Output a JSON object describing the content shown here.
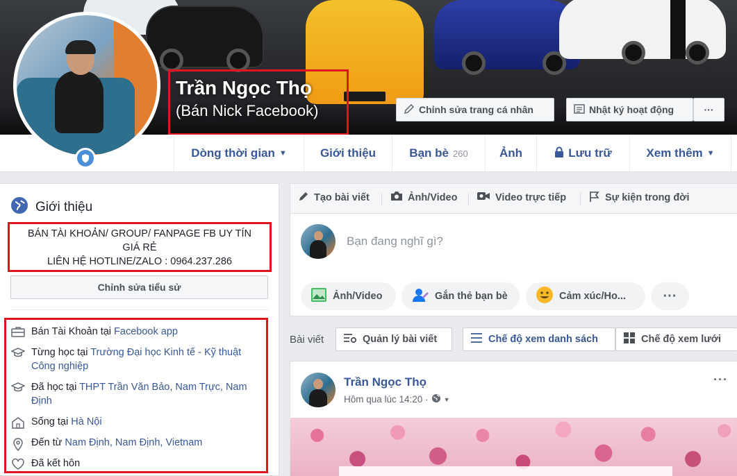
{
  "profile": {
    "name": "Trần Ngọc Thọ",
    "alt_name": "(Bán Nick Facebook)"
  },
  "cover_buttons": {
    "edit_profile": "Chỉnh sửa trang cá nhân",
    "activity_log": "Nhật ký hoạt động",
    "more": "···"
  },
  "nav": {
    "timeline": "Dòng thời gian",
    "about": "Giới thiệu",
    "friends": "Bạn bè",
    "friends_count": "260",
    "photos": "Ảnh",
    "archive": "Lưu trữ",
    "more": "Xem thêm"
  },
  "intro": {
    "title": "Giới thiệu",
    "bio_line1": "BÁN TÀI KHOẢN/ GROUP/ FANPAGE FB UY TÍN",
    "bio_line2": "GIÁ RẺ",
    "bio_line3": "LIÊN HỆ HOTLINE/ZALO : 0964.237.286",
    "edit_bio": "Chỉnh sửa tiểu sử",
    "work_prefix": "Bán Tài Khoản tại ",
    "work_link": "Facebook app",
    "college_prefix": "Từng học tại ",
    "college_link": "Trường Đại học Kinh tế - Kỹ thuật Công nghiệp",
    "highschool_prefix": "Đã học tại ",
    "highschool_link": "THPT Trần Văn Bảo, Nam Trực, Nam Định",
    "lives_prefix": "Sống tại ",
    "lives_link": "Hà Nội",
    "from_prefix": "Đến từ ",
    "from_link": "Nam Định, Nam Định, Vietnam",
    "relationship": "Đã kết hôn"
  },
  "composer": {
    "tab_create": "Tạo bài viết",
    "tab_photo": "Ảnh/Video",
    "tab_live": "Video trực tiếp",
    "tab_event": "Sự kiện trong đời",
    "placeholder": "Bạn đang nghĩ gì?",
    "chip_photo": "Ảnh/Video",
    "chip_tag": "Gắn thẻ bạn bè",
    "chip_feeling": "Cảm xúc/Ho...",
    "chip_more": "···"
  },
  "posts_bar": {
    "label": "Bài viết",
    "manage": "Quản lý bài viết",
    "list_view": "Chế độ xem danh sách",
    "grid_view": "Chế độ xem lưới"
  },
  "post": {
    "author": "Trần Ngọc Thọ",
    "time": "Hôm qua lúc 14:20 ·",
    "menu": "···"
  },
  "colors": {
    "link": "#385898",
    "highlight_box": "#e0141e",
    "page_bg": "#e9ebee"
  }
}
